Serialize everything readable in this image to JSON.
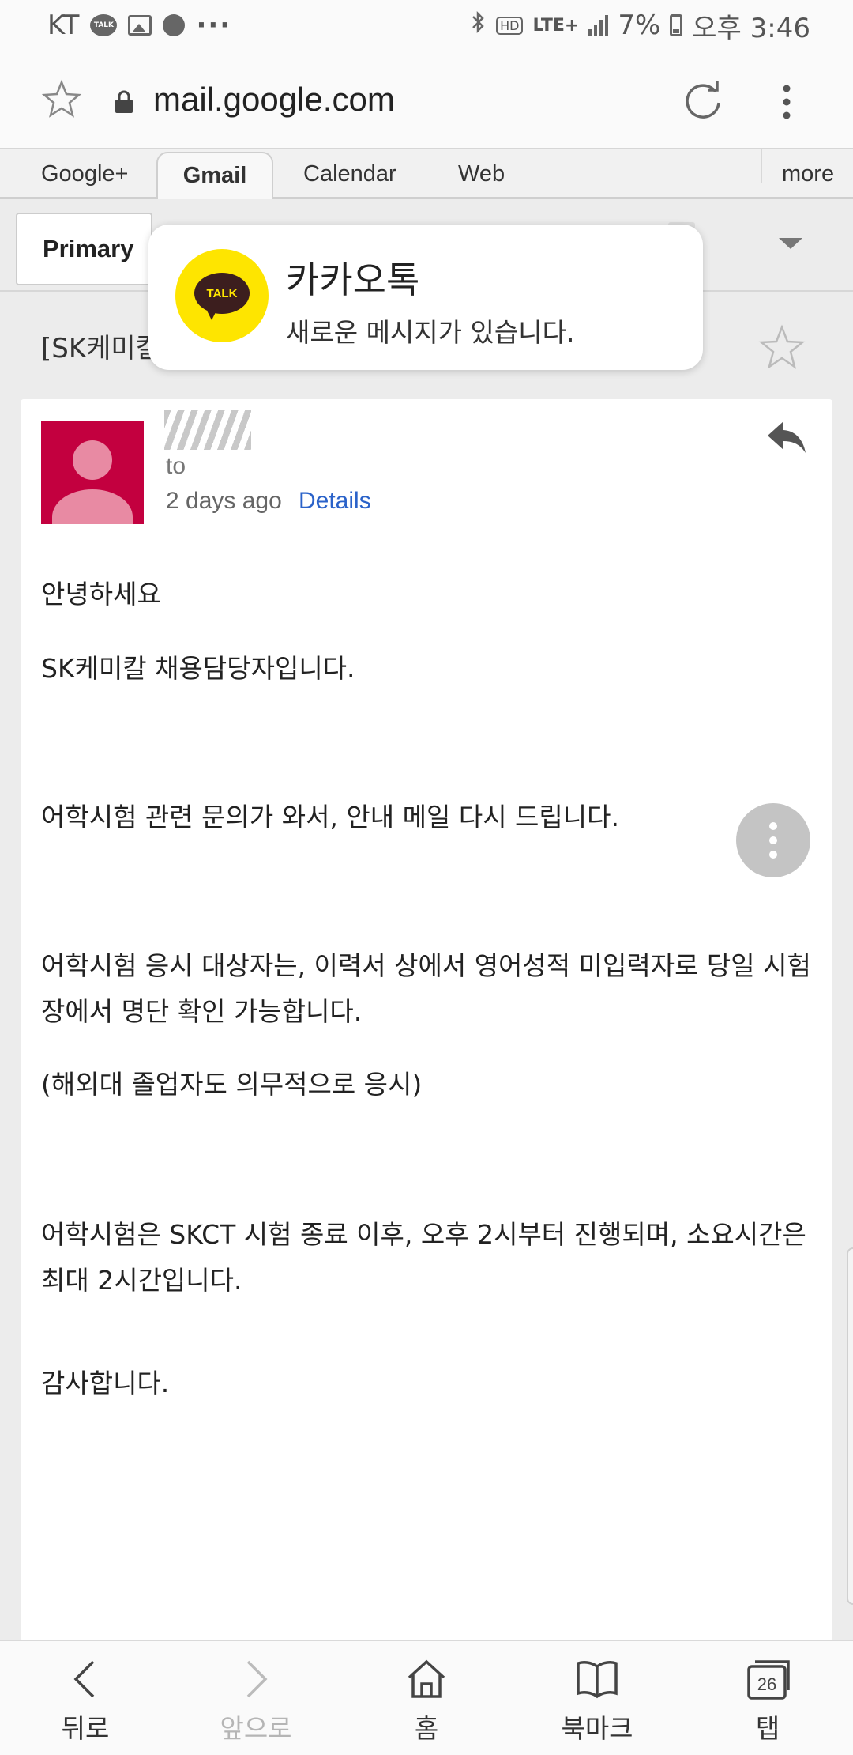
{
  "status_bar": {
    "carrier": "KT",
    "kakao_mini": "TALK",
    "hd": "HD",
    "lte": "LTE+",
    "battery": "7%",
    "time": "오후 3:46"
  },
  "browser": {
    "url": "mail.google.com"
  },
  "gmail_tabs": {
    "google_plus": "Google+",
    "gmail": "Gmail",
    "calendar": "Calendar",
    "web": "Web",
    "more": "more"
  },
  "toolbar": {
    "primary_label": "Primary"
  },
  "email": {
    "subject": "[SK케미칼/SK바이오사이언스] 어학시험 관련 추가 안내",
    "to_label": "to",
    "date": "2 days ago",
    "details": "Details",
    "body": [
      "안녕하세요",
      "SK케미칼 채용담당자입니다.",
      "어학시험 관련 문의가 와서, 안내 메일 다시 드립니다.",
      "어학시험 응시 대상자는, 이력서 상에서 영어성적 미입력자로 당일 시험장에서 명단 확인 가능합니다.",
      "(해외대 졸업자도 의무적으로 응시)",
      "어학시험은 SKCT 시험 종료 이후, 오후 2시부터 진행되며, 소요시간은 최대 2시간입니다.",
      "감사합니다."
    ]
  },
  "notification": {
    "app": "카카오톡",
    "message": "새로운 메시지가 있습니다.",
    "logo_text": "TALK"
  },
  "bottom_nav": {
    "back": "뒤로",
    "forward": "앞으로",
    "home": "홈",
    "bookmarks": "북마크",
    "tabs": "탭",
    "tab_count": "26"
  },
  "colors": {
    "kakao_yellow": "#fee500",
    "avatar_red": "#c3003f",
    "link_blue": "#2a62c9"
  }
}
